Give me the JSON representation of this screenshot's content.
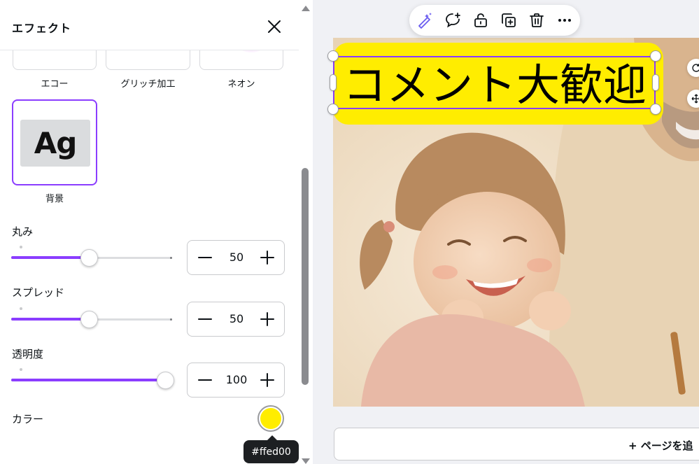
{
  "panel": {
    "title": "エフェクト",
    "effects": [
      {
        "label": "エコー"
      },
      {
        "label": "グリッチ加工"
      },
      {
        "label": "ネオン"
      }
    ],
    "selected_effect": {
      "label": "背景",
      "preview_text": "Ag"
    },
    "controls": [
      {
        "label": "丸み",
        "value": "50",
        "level": 0.5
      },
      {
        "label": "スプレッド",
        "value": "50",
        "level": 0.5
      },
      {
        "label": "透明度",
        "value": "100",
        "level": 1.0
      }
    ],
    "color": {
      "label": "カラー",
      "value": "#ffed00",
      "tooltip": "#ffed00"
    }
  },
  "toolbar": {
    "icons": [
      "magic-edit-icon",
      "comment-icon",
      "unlock-icon",
      "duplicate-icon",
      "trash-icon",
      "more-icon"
    ]
  },
  "canvas": {
    "text": "コメント大歓迎",
    "text_bg_color": "#ffed00",
    "add_page_label": "+ ページを追"
  },
  "colors": {
    "accent": "#8b3dff"
  }
}
